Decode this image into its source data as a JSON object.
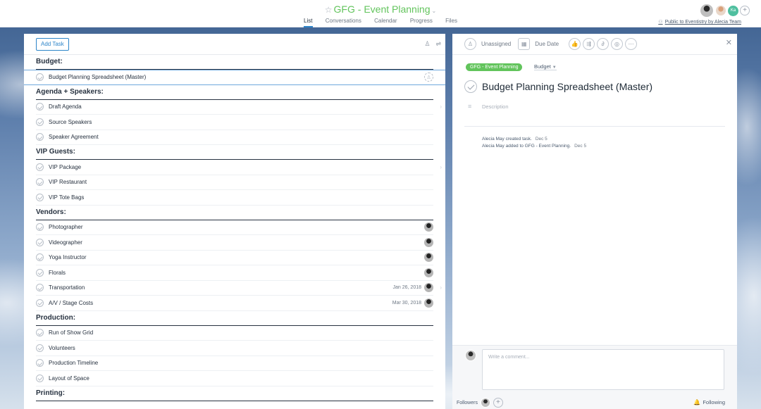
{
  "header": {
    "title": "GFG - Event Planning",
    "tabs": [
      {
        "label": "List",
        "active": true
      },
      {
        "label": "Conversations",
        "active": false
      },
      {
        "label": "Calendar",
        "active": false
      },
      {
        "label": "Progress",
        "active": false
      },
      {
        "label": "Files",
        "active": false
      }
    ],
    "member_initials": "Ka",
    "public_link": "Public to Eventistry by Alecia Team"
  },
  "list": {
    "add_task_label": "Add Task",
    "sections": [
      {
        "title": "Budget:",
        "tasks": [
          {
            "name": "Budget Planning Spreadsheet (Master)",
            "due": "",
            "assignee": "empty",
            "selected": true
          }
        ]
      },
      {
        "title": "Agenda + Speakers:",
        "tasks": [
          {
            "name": "Draft Agenda",
            "due": "",
            "assignee": "none",
            "chevron": true
          },
          {
            "name": "Source Speakers",
            "due": "",
            "assignee": "none"
          },
          {
            "name": "Speaker Agreement",
            "due": "",
            "assignee": "none"
          }
        ]
      },
      {
        "title": "VIP Guests:",
        "tasks": [
          {
            "name": "VIP Package",
            "due": "",
            "assignee": "none",
            "chevron": true
          },
          {
            "name": "VIP Restaurant",
            "due": "",
            "assignee": "none"
          },
          {
            "name": "VIP Tote Bags",
            "due": "",
            "assignee": "none"
          }
        ]
      },
      {
        "title": "Vendors:",
        "tasks": [
          {
            "name": "Photographer",
            "due": "",
            "assignee": "photo"
          },
          {
            "name": "Videographer",
            "due": "",
            "assignee": "photo"
          },
          {
            "name": "Yoga Instructor",
            "due": "",
            "assignee": "photo"
          },
          {
            "name": "Florals",
            "due": "",
            "assignee": "photo"
          },
          {
            "name": "Transportation",
            "due": "Jan 26, 2018",
            "assignee": "photo",
            "chevron": true
          },
          {
            "name": "A/V / Stage Costs",
            "due": "Mar 30, 2018",
            "assignee": "photo"
          }
        ]
      },
      {
        "title": "Production:",
        "tasks": [
          {
            "name": "Run of Show Grid",
            "due": "",
            "assignee": "none"
          },
          {
            "name": "Volunteers",
            "due": "",
            "assignee": "none"
          },
          {
            "name": "Production Timeline",
            "due": "",
            "assignee": "none"
          },
          {
            "name": "Layout of Space",
            "due": "",
            "assignee": "none"
          }
        ]
      },
      {
        "title": "Printing:",
        "tasks": []
      }
    ]
  },
  "detail": {
    "assignee_label": "Unassigned",
    "due_label": "Due Date",
    "project_pill": "GFG - Event Planning",
    "section_label": "Budget",
    "title": "Budget Planning Spreadsheet (Master)",
    "description_placeholder": "Description",
    "stories": [
      {
        "text": "Alecia May created task.",
        "date": "Dec 5"
      },
      {
        "text": "Alecia May added to GFG - Event Planning.",
        "date": "Dec 5"
      }
    ],
    "comment_placeholder": "Write a comment...",
    "followers_label": "Followers",
    "following_label": "Following"
  }
}
